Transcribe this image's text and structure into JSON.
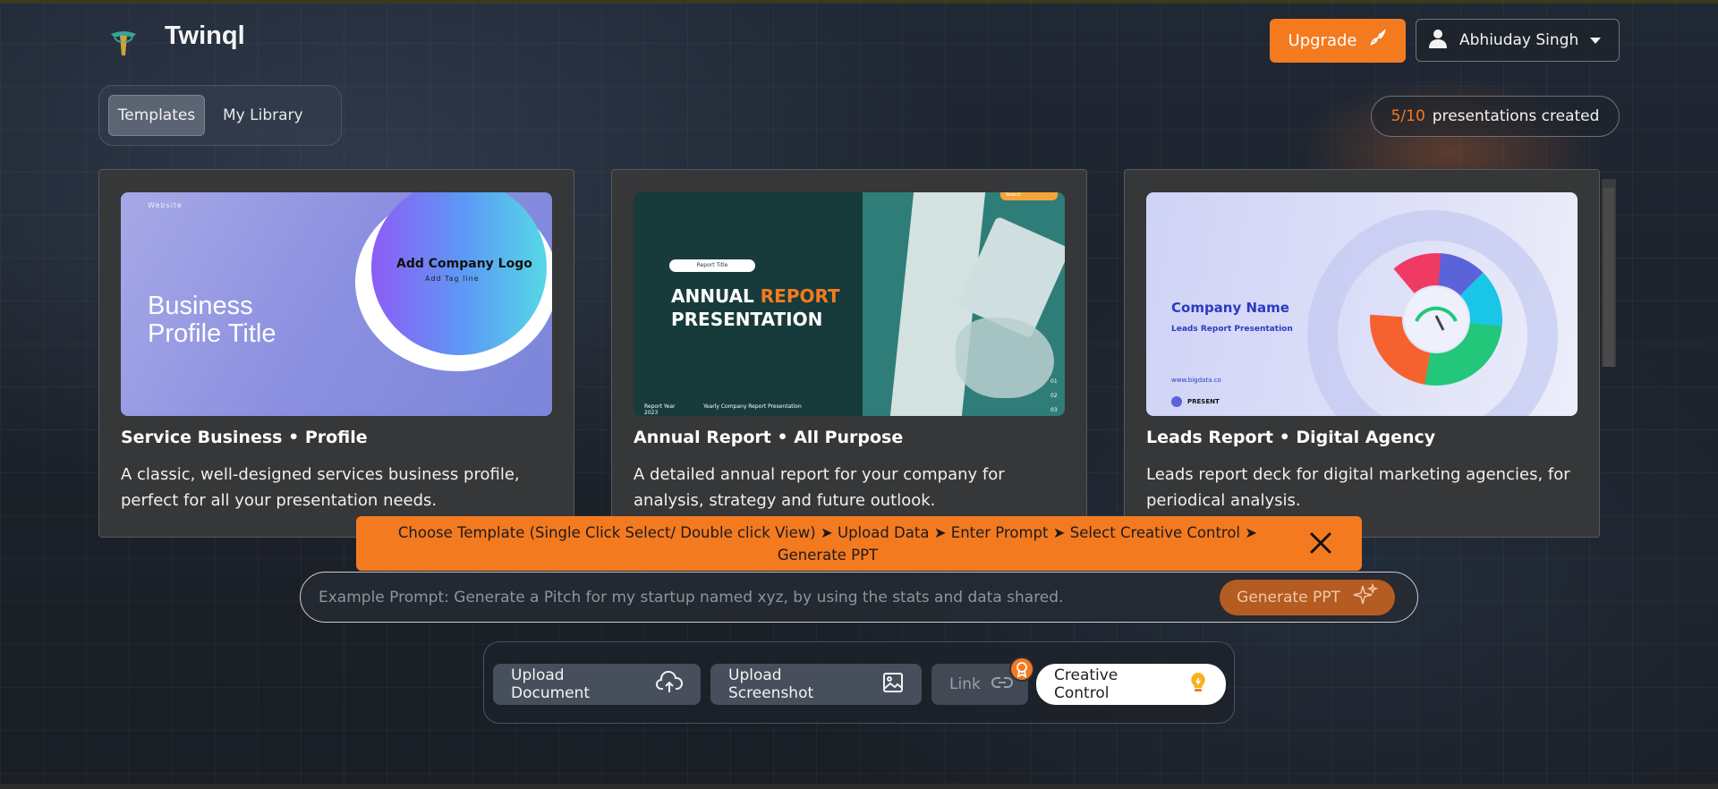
{
  "app": {
    "name": "Twinql"
  },
  "header": {
    "upgrade_label": "Upgrade",
    "user_name": "Abhiuday Singh"
  },
  "tabs": [
    {
      "label": "Templates",
      "active": true
    },
    {
      "label": "My Library",
      "active": false
    }
  ],
  "counter": {
    "count": "5/10",
    "text": "presentations created"
  },
  "templates": [
    {
      "title": "Service Business • Profile",
      "description": "A classic, well-designed services business profile, perfect for all your presentation needs.",
      "thumb": {
        "website": "Website",
        "logo": "Add Company Logo",
        "tagline": "Add Tag line",
        "heading_line1": "Business",
        "heading_line2": "Profile Title"
      }
    },
    {
      "title": "Annual Report • All Purpose",
      "description": "A detailed annual report for your company for analysis, strategy and future outlook.",
      "thumb": {
        "pill": "Report Title",
        "heading_white": "ANNUAL",
        "heading_orange": "REPORT",
        "heading_line2": "PRESENTATION",
        "footer_left_line1": "Report Year",
        "footer_left_line2": "2023",
        "footer_right": "Yearly Company Report Presentation",
        "search": "Search",
        "nums": [
          "01",
          "02",
          "03"
        ]
      }
    },
    {
      "title": "Leads Report • Digital Agency",
      "description": "Leads report deck for digital marketing agencies, for periodical analysis.",
      "thumb": {
        "company": "Company Name",
        "subtitle": "Leads Report Presentation",
        "url": "www.bigdata.co",
        "present": "PRESENT"
      }
    }
  ],
  "banner": {
    "text": "Choose Template (Single Click Select/ Double click View) ➤ Upload Data ➤ Enter Prompt ➤ Select Creative Control ➤ Generate PPT"
  },
  "prompt": {
    "placeholder": "Example Prompt: Generate a Pitch for my startup named xyz, by using the stats and data shared.",
    "button_label": "Generate PPT"
  },
  "toolbar": {
    "upload_document": "Upload Document",
    "upload_screenshot": "Upload Screenshot",
    "link": "Link",
    "creative_control": "Creative Control"
  },
  "colors": {
    "accent": "#f47a20",
    "card_bg": "#363738",
    "brand_blue": "#2b3cbf"
  }
}
